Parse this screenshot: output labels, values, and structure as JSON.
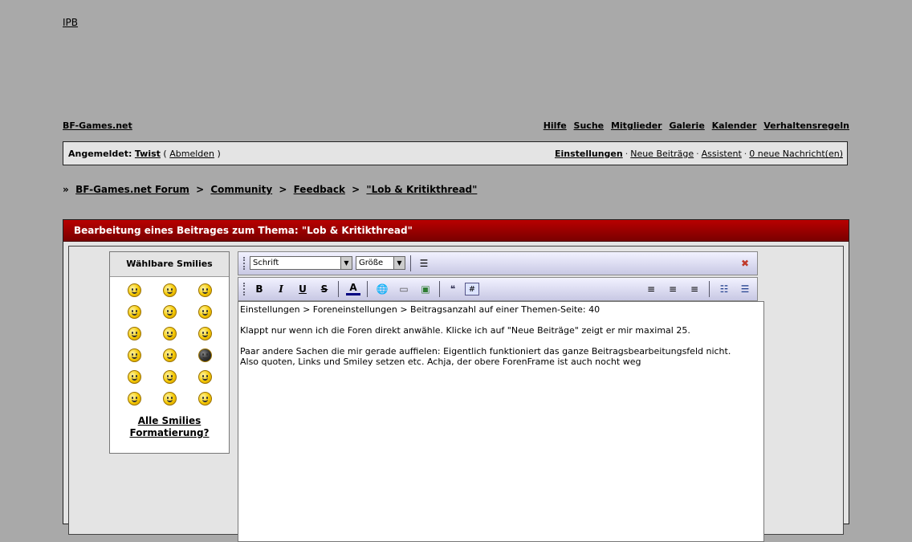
{
  "logo": "IPB",
  "site_name": "BF-Games.net",
  "top_nav": [
    "Hilfe",
    "Suche",
    "Mitglieder",
    "Galerie",
    "Kalender",
    "Verhaltensregeln"
  ],
  "userbar": {
    "logged_in_label": "Angemeldet:",
    "username": "Twist",
    "logout_open": "(",
    "logout": "Abmelden",
    "logout_close": ")",
    "links": [
      "Einstellungen",
      "Neue Beiträge",
      "Assistent",
      "0 neue Nachricht(en)"
    ]
  },
  "breadcrumb": {
    "prefix": "»",
    "items": [
      "BF-Games.net Forum",
      "Community",
      "Feedback",
      "\"Lob & Kritikthread\""
    ],
    "separator": ">"
  },
  "panel": {
    "title": "Bearbeitung eines Beitrages zum Thema: \"Lob & Kritikthread\""
  },
  "smilies": {
    "title": "Wählbare Smilies",
    "all_link": "Alle Smilies",
    "format_link": "Formatierung?"
  },
  "toolbar": {
    "font_select": "Schrift",
    "size_select": "Größe",
    "bold": "B",
    "italic": "I",
    "underline": "U",
    "strike": "S",
    "color_letter": "A",
    "hash": "#"
  },
  "editor": {
    "lines": [
      "Einstellungen > Foreneinstellungen > Beitragsanzahl auf einer Themen-Seite: 40",
      "",
      "Klappt nur wenn ich die Foren direkt anwähle. Klicke ich auf \"Neue Beiträge\" zeigt er mir maximal 25.",
      "",
      "Paar andere Sachen die mir gerade auffielen: Eigentlich funktioniert das ganze Beitragsbearbeitungsfeld nicht.",
      "Also quoten, Links und Smiley setzen etc. Achja, der obere ForenFrame ist auch nocht weg"
    ]
  },
  "colors": {
    "background": "#a9a9a9",
    "header_red": "#b80000",
    "panel_bg": "#e4e4e4"
  }
}
